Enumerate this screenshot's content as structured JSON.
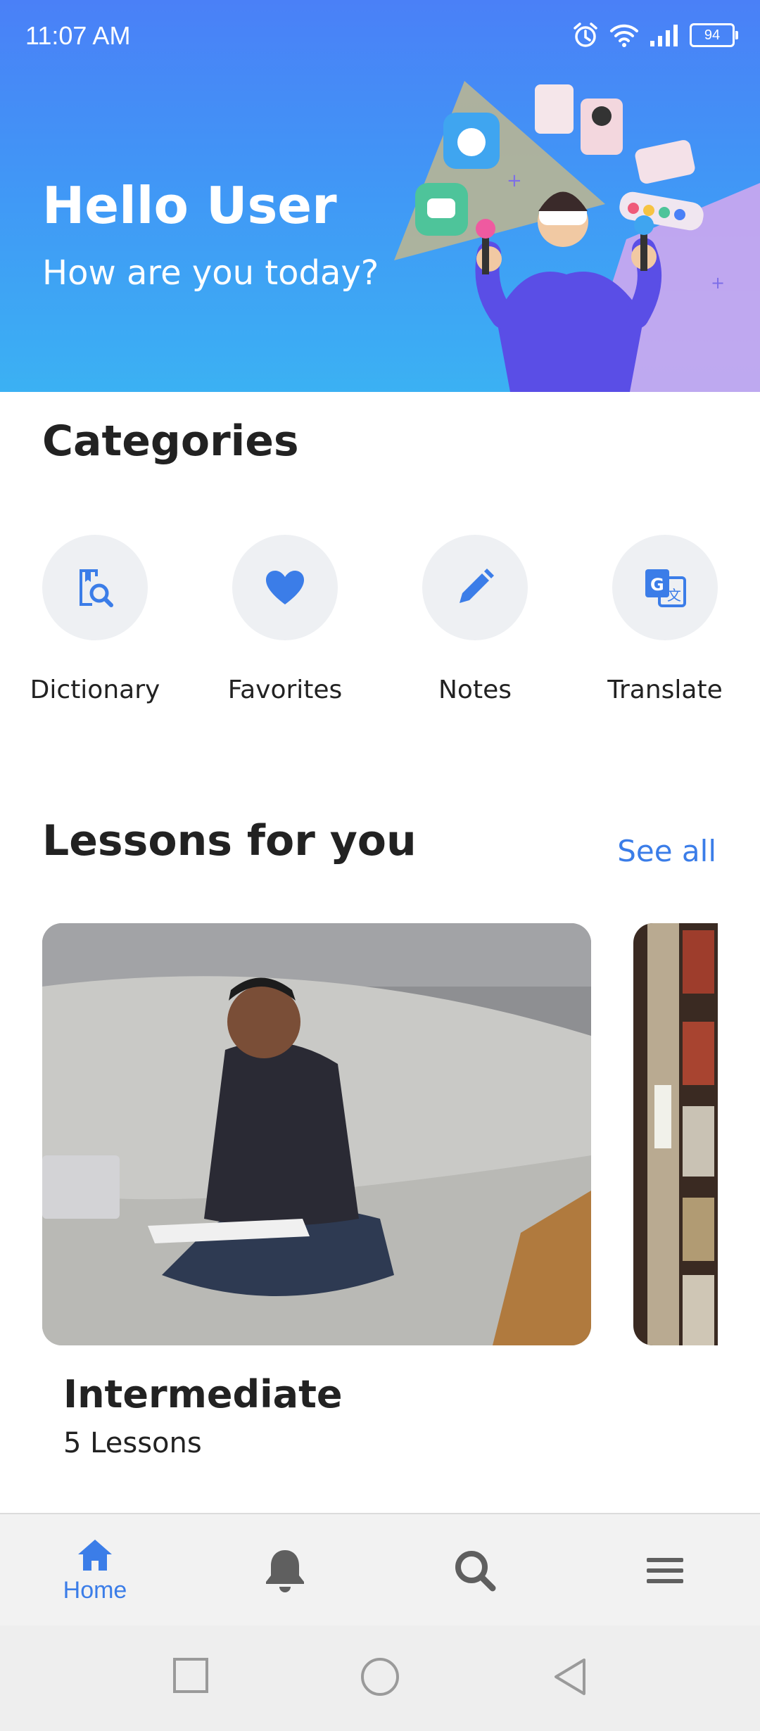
{
  "status_bar": {
    "time": "11:07 AM",
    "battery": "94"
  },
  "header": {
    "title": "Hello User",
    "subtitle": "How are you today?"
  },
  "categories": {
    "title": "Categories",
    "items": [
      {
        "label": "Dictionary",
        "icon": "dictionary-search-icon"
      },
      {
        "label": "Favorites",
        "icon": "heart-icon"
      },
      {
        "label": "Notes",
        "icon": "pencil-icon"
      },
      {
        "label": "Translate",
        "icon": "translate-icon"
      }
    ]
  },
  "lessons": {
    "title": "Lessons for you",
    "see_all": "See all",
    "cards": [
      {
        "title": "Intermediate",
        "count": "5 Lessons"
      }
    ]
  },
  "bottom_nav": {
    "items": [
      {
        "label": "Home",
        "icon": "home-icon",
        "active": true
      },
      {
        "icon": "bell-icon"
      },
      {
        "icon": "search-icon"
      },
      {
        "icon": "menu-icon"
      }
    ]
  },
  "colors": {
    "accent": "#3b7de8",
    "header_top": "#4a80f7",
    "header_bottom": "#3bb1f3"
  }
}
